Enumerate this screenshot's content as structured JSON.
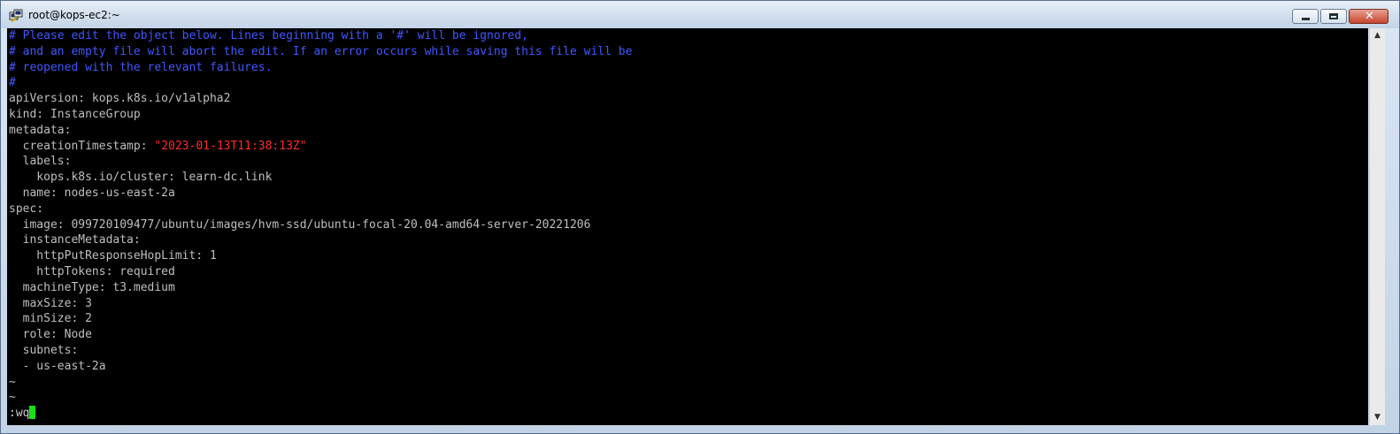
{
  "window": {
    "title": "root@kops-ec2:~",
    "controls": {
      "minimize": "—",
      "maximize": "☐",
      "close": "✕"
    }
  },
  "terminal": {
    "lines": [
      {
        "text": "# Please edit the object below. Lines beginning with a '#' will be ignored,",
        "style": "comment"
      },
      {
        "text": "# and an empty file will abort the edit. If an error occurs while saving this file will be",
        "style": "comment"
      },
      {
        "text": "# reopened with the relevant failures.",
        "style": "comment"
      },
      {
        "text": "#",
        "style": "comment"
      },
      {
        "text": "apiVersion: kops.k8s.io/v1alpha2",
        "style": "normal"
      },
      {
        "text": "kind: InstanceGroup",
        "style": "normal"
      },
      {
        "text": "metadata:",
        "style": "normal"
      },
      {
        "text": "  creationTimestamp: ",
        "value": "\"2023-01-13T11:38:13Z\"",
        "style": "normal"
      },
      {
        "text": "  labels:",
        "style": "normal"
      },
      {
        "text": "    kops.k8s.io/cluster: learn-dc.link",
        "style": "normal"
      },
      {
        "text": "  name: nodes-us-east-2a",
        "style": "normal"
      },
      {
        "text": "spec:",
        "style": "normal"
      },
      {
        "text": "  image: 099720109477/ubuntu/images/hvm-ssd/ubuntu-focal-20.04-amd64-server-20221206",
        "style": "normal"
      },
      {
        "text": "  instanceMetadata:",
        "style": "normal"
      },
      {
        "text": "    httpPutResponseHopLimit: 1",
        "style": "normal"
      },
      {
        "text": "    httpTokens: required",
        "style": "normal"
      },
      {
        "text": "  machineType: t3.medium",
        "style": "normal"
      },
      {
        "text": "  maxSize: 3",
        "style": "normal"
      },
      {
        "text": "  minSize: 2",
        "style": "normal"
      },
      {
        "text": "  role: Node",
        "style": "normal"
      },
      {
        "text": "  subnets:",
        "style": "normal"
      },
      {
        "text": "  - us-east-2a",
        "style": "normal"
      },
      {
        "text": "~",
        "style": "normal"
      },
      {
        "text": "~",
        "style": "normal"
      }
    ],
    "command_line": ":wq"
  },
  "scrollbar": {
    "up_arrow": "▲",
    "down_arrow": "▼"
  }
}
